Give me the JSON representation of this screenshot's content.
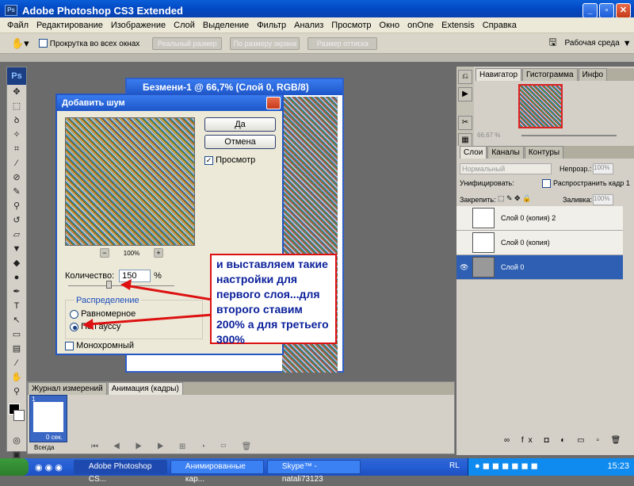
{
  "window": {
    "title": "Adobe Photoshop CS3 Extended",
    "logo": "Ps"
  },
  "menu": [
    "Файл",
    "Редактирование",
    "Изображение",
    "Слой",
    "Выделение",
    "Фильтр",
    "Анализ",
    "Просмотр",
    "Окно",
    "onOne",
    "Extensis",
    "Справка"
  ],
  "options": {
    "scroll_all": "Прокрутка во всех окнах",
    "btn1": "Реальный размер",
    "btn2": "По размеру экрана",
    "btn3": "Размер оттиска",
    "workspace": "Рабочая среда"
  },
  "document": {
    "title": "Безмени-1 @ 66,7% (Слой 0, RGB/8)"
  },
  "dialog": {
    "title": "Добавить шум",
    "ok": "Да",
    "cancel": "Отмена",
    "preview": "Просмотр",
    "zoom": "100%",
    "amount_label": "Количество:",
    "amount_value": "150",
    "amount_unit": "%",
    "distribution": "Распределение",
    "uniform": "Равномерное",
    "gaussian": "По Гауссу",
    "monochrome": "Монохромный"
  },
  "callout": {
    "text": "и выставляем такие настройки для первого слоя...для второго ставим 200% а для третьего 300%"
  },
  "navigator": {
    "tabs": [
      "Навигатор",
      "Гистограмма",
      "Инфо"
    ],
    "zoom": "66,67 %"
  },
  "layers": {
    "tabs": [
      "Слои",
      "Каналы",
      "Контуры"
    ],
    "blend": "Нормальный",
    "opacity_label": "Непрозр.:",
    "opacity": "100%",
    "unify_label": "Унифицировать:",
    "propagate": "Распространить кадр 1",
    "lock_label": "Закрепить:",
    "fill_label": "Заливка:",
    "fill": "100%",
    "items": [
      {
        "name": "Слой 0 (копия) 2"
      },
      {
        "name": "Слой 0 (копия)"
      },
      {
        "name": "Слой 0"
      }
    ]
  },
  "animation": {
    "tabs": [
      "Журнал измерений",
      "Анимация (кадры)"
    ],
    "frame_num": "1",
    "frame_time": "0 сек.",
    "loop": "Всегда"
  },
  "taskbar": {
    "items": [
      "Adobe Photoshop CS...",
      "Анимированные кар...",
      "Skype™ - natali73123"
    ],
    "lang": "RL",
    "time": "15:23"
  }
}
